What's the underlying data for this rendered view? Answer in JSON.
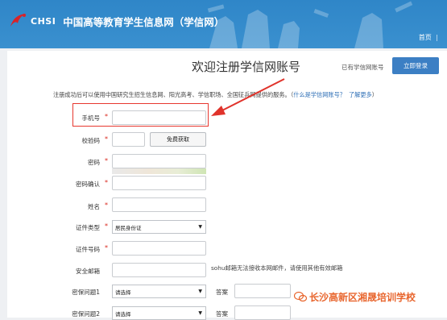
{
  "header": {
    "logo_en": "CHSI",
    "logo_cn": "中国高等教育学生信息网（学信网）",
    "nav_home": "首页",
    "nav_sep": "|"
  },
  "page": {
    "title": "欢迎注册学信网账号",
    "have_account": "已有学信网账号",
    "login_button": "立即登录",
    "intro_text": "注册成功后可以使用中国研究生招生信息网、阳光高考、学信职场、全国征兵网提供的服务。（",
    "intro_link1": "什么是学信网账号？",
    "intro_link2": "了解更多",
    "intro_end": "）"
  },
  "form": {
    "phone_label": "手机号",
    "code_label": "校验码",
    "code_button": "免费获取",
    "password_label": "密码",
    "password_confirm_label": "密码确认",
    "name_label": "姓名",
    "id_type_label": "证件类型",
    "id_type_value": "居民身份证",
    "id_number_label": "证件号码",
    "email_label": "安全邮箱",
    "email_hint": "sohu邮箱无法接收本网邮件，请使用其他有效邮箱",
    "q1_label": "密保问题1",
    "q1_value": "请选择",
    "q2_label": "密保问题2",
    "q2_value": "请选择",
    "answer_label": "答案",
    "required_mark": "*"
  },
  "watermark": {
    "text": "长沙高新区湘晟培训学校"
  },
  "colors": {
    "header_blue": "#3a90cf",
    "required_red": "#d9261c",
    "highlight_red": "#e7372f",
    "button_blue": "#3c7fc4",
    "watermark_orange": "#e8652d"
  }
}
